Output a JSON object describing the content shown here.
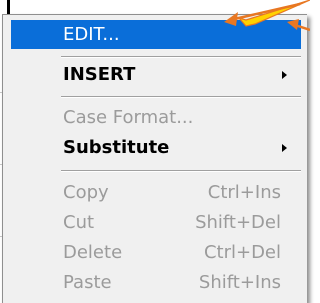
{
  "menu": {
    "items": [
      {
        "label": "EDIT...",
        "accel": "",
        "state": "highlighted"
      },
      {
        "label": "INSERT",
        "accel": "",
        "state": "submenu"
      },
      {
        "label": "Case Format...",
        "accel": "",
        "state": "disabled"
      },
      {
        "label": "Substitute",
        "accel": "",
        "state": "submenu"
      },
      {
        "label": "Copy",
        "accel": "Ctrl+Ins",
        "state": "disabled"
      },
      {
        "label": "Cut",
        "accel": "Shift+Del",
        "state": "disabled"
      },
      {
        "label": "Delete",
        "accel": "Ctrl+Del",
        "state": "disabled"
      },
      {
        "label": "Paste",
        "accel": "Shift+Ins",
        "state": "disabled"
      }
    ]
  },
  "colors": {
    "highlight": "#0a6ed9",
    "disabled_text": "#9b9b9b",
    "menu_background": "#f0f0f0",
    "arrow_orange": "#e87722",
    "arrow_yellow": "#ffd200"
  },
  "icons": {
    "submenu_arrow": "chevron-right-icon",
    "pointer_arrows": "pointer-arrow-icon"
  }
}
